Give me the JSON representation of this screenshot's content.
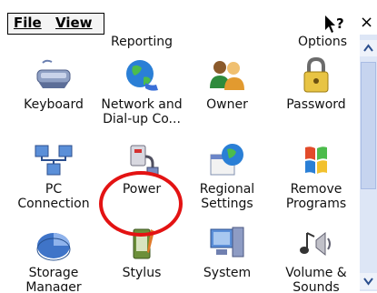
{
  "menu": {
    "file": "File",
    "view": "View"
  },
  "toolbar": {
    "help_icon": "help-icon",
    "close_label": "×"
  },
  "cut_labels": [
    "Reporting",
    "Options"
  ],
  "items": [
    {
      "label": "Keyboard",
      "icon": "keyboard-icon"
    },
    {
      "label": "Network and\nDial-up Co...",
      "icon": "network-icon"
    },
    {
      "label": "Owner",
      "icon": "owner-icon"
    },
    {
      "label": "Password",
      "icon": "password-icon"
    },
    {
      "label": "PC\nConnection",
      "icon": "pc-connection-icon"
    },
    {
      "label": "Power",
      "icon": "power-icon"
    },
    {
      "label": "Regional\nSettings",
      "icon": "regional-settings-icon"
    },
    {
      "label": "Remove\nPrograms",
      "icon": "remove-programs-icon"
    },
    {
      "label": "Storage\nManager",
      "icon": "storage-manager-icon"
    },
    {
      "label": "Stylus",
      "icon": "stylus-icon"
    },
    {
      "label": "System",
      "icon": "system-icon"
    },
    {
      "label": "Volume &\nSounds",
      "icon": "volume-sounds-icon"
    }
  ],
  "colors": {
    "annotation": "#e31313",
    "scrollbar": "#dde6f6"
  }
}
